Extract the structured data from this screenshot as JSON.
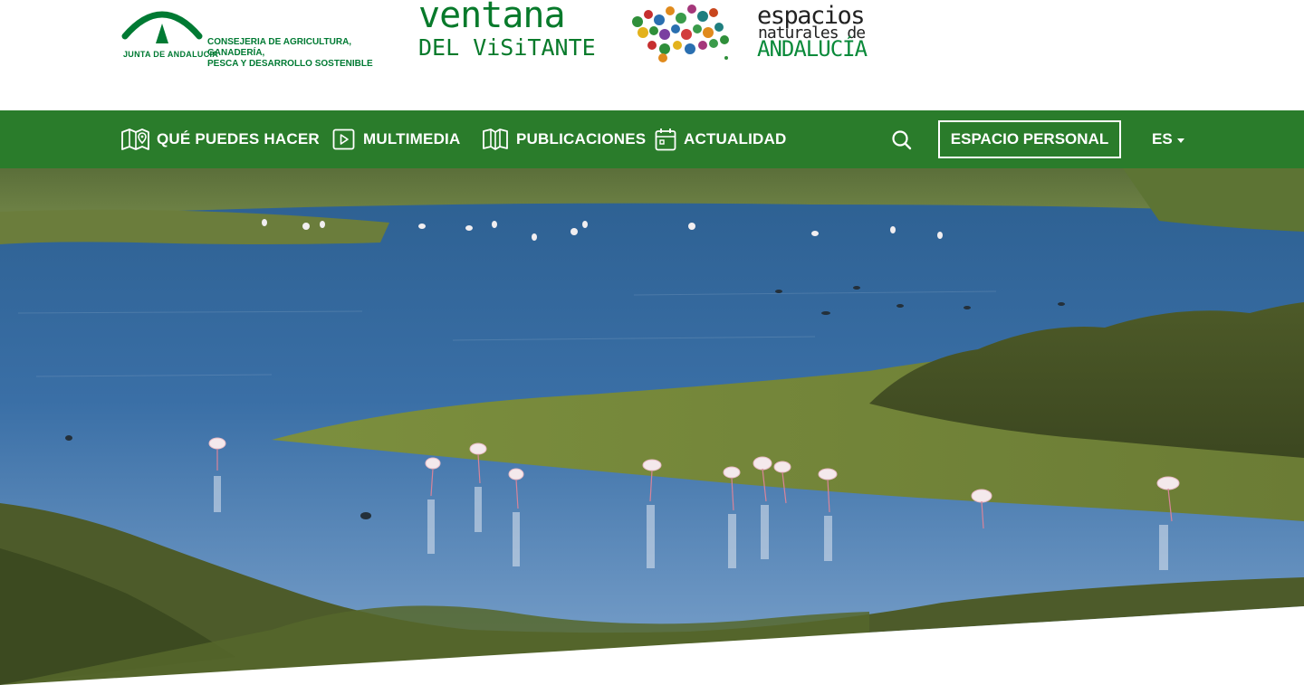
{
  "header": {
    "junta": {
      "name": "JUNTA DE ANDALUCIA",
      "consejeria_line1": "CONSEJERIA DE AGRICULTURA, GANADERÍA,",
      "consejeria_line2": "PESCA Y DESARROLLO SOSTENIBLE"
    },
    "ventana": {
      "line1": "ventana",
      "line2": "DEL ViSiTANTE"
    },
    "espacios": {
      "line1": "espacios",
      "line2": "naturales de",
      "line3": "ANDALUCÍA"
    }
  },
  "nav": {
    "items": [
      {
        "label": "QUÉ PUEDES HACER",
        "icon": "map-pin-icon"
      },
      {
        "label": "MULTIMEDIA",
        "icon": "play-icon"
      },
      {
        "label": "PUBLICACIONES",
        "icon": "book-icon"
      },
      {
        "label": "ACTUALIDAD",
        "icon": "calendar-icon"
      }
    ],
    "search_icon": "search-icon",
    "personal_label": "ESPACIO PERSONAL",
    "lang_label": "ES"
  },
  "hero": {
    "image": "flamingos-lagoon-photo"
  },
  "colors": {
    "nav_bg": "#2a7c2b",
    "brand_green": "#087a2b",
    "white": "#ffffff"
  }
}
